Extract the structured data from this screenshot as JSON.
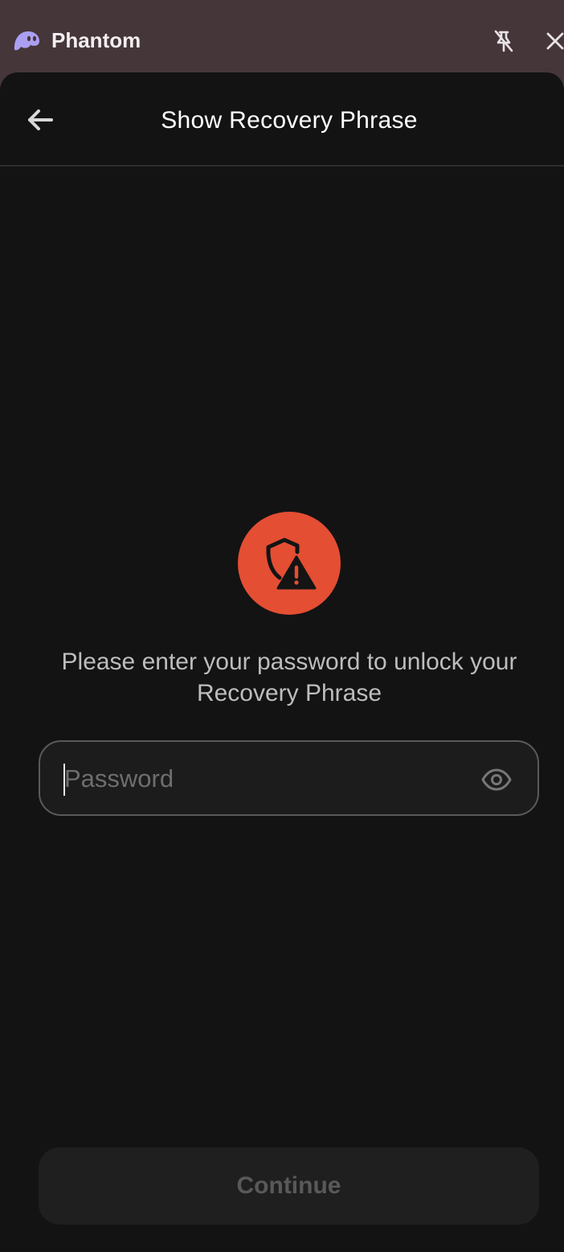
{
  "window": {
    "app_title": "Phantom",
    "app_icon": "phantom-ghost-icon",
    "pin_icon": "pin-off-icon",
    "close_icon": "close-icon"
  },
  "header": {
    "back_icon": "arrow-left-icon",
    "title": "Show Recovery Phrase"
  },
  "main": {
    "warning_icon": "shield-alert-icon",
    "prompt": "Please enter your password to unlock your Recovery Phrase",
    "password_field": {
      "value": "",
      "placeholder": "Password",
      "toggle_icon": "eye-icon"
    },
    "continue_label": "Continue"
  },
  "colors": {
    "titlebar": "#45363a",
    "background": "#131313",
    "accent_purple": "#ab9ff2",
    "warning_red": "#e44e33",
    "button_disabled": "#1f1f1f",
    "button_disabled_text": "#595959"
  }
}
